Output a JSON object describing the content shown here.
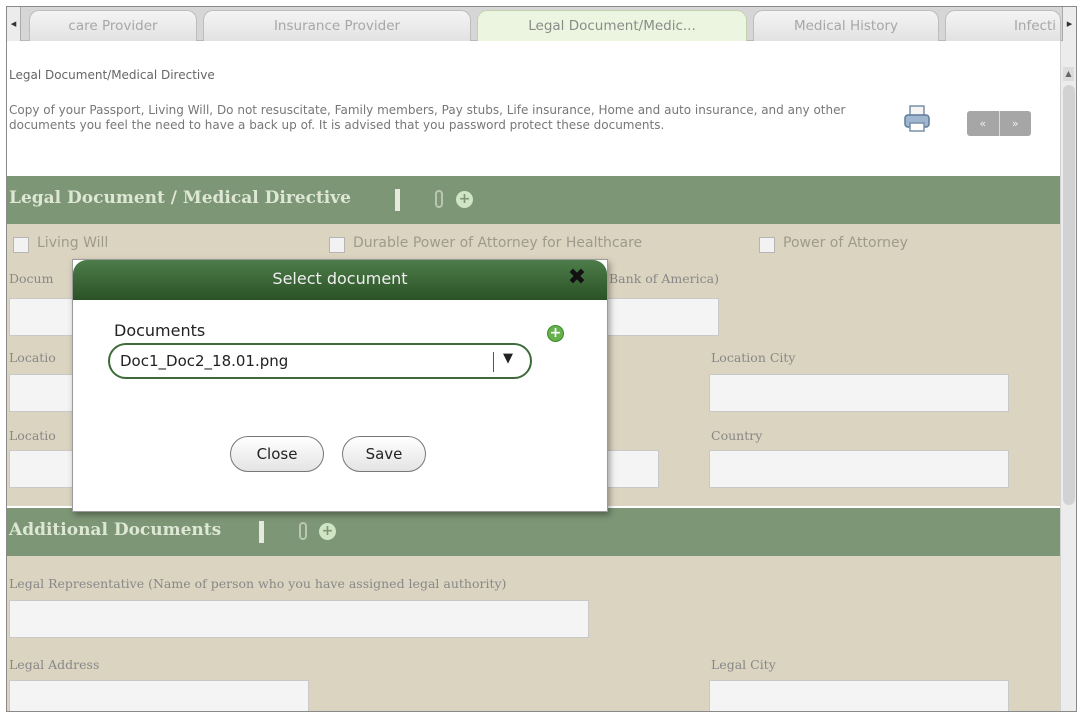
{
  "tabs": {
    "prev_arrow": "◂",
    "next_arrow": "▸",
    "items": [
      {
        "label": "care Provider"
      },
      {
        "label": "Insurance Provider"
      },
      {
        "label": "Legal Document/Medic..."
      },
      {
        "label": "Medical History"
      },
      {
        "label": "Infecti"
      }
    ],
    "active_index": 2
  },
  "page": {
    "breadcrumb": "Legal Document/Medical Directive",
    "description": "Copy of your Passport, Living Will, Do not resuscitate, Family members, Pay stubs, Life insurance, Home and auto insurance, and any other documents you feel the need to have a back up of. It is advised that you password protect these documents.",
    "pager_prev": "«",
    "pager_next": "»"
  },
  "section_legal": {
    "title": "Legal Document / Medical Directive",
    "checkboxes": [
      {
        "label": "Living Will",
        "checked": false
      },
      {
        "label": "Durable Power of Attorney for Healthcare",
        "checked": false
      },
      {
        "label": "Power of Attorney",
        "checked": false
      }
    ],
    "document_label": "Docum",
    "bank_hint": "Bank of America)",
    "location_label_1": "Locatio",
    "location_city_label": "Location City",
    "location_label_2": "Locatio",
    "country_label": "Country"
  },
  "section_additional": {
    "title": "Additional Documents",
    "legal_rep_label": "Legal Representative (Name of person who you have assigned legal authority)",
    "legal_address_label": "Legal Address",
    "legal_city_label": "Legal City"
  },
  "modal": {
    "title": "Select document",
    "close_glyph": "✖",
    "documents_label": "Documents",
    "add_glyph": "+",
    "selected_document": "Doc1_Doc2_18.01.png",
    "dropdown_glyph": "▼",
    "close_button": "Close",
    "save_button": "Save"
  },
  "colors": {
    "section_bar": "#7d9676",
    "panel_bg": "#dbd4c0",
    "modal_header": "#2a5226",
    "active_tab": "#ecf5df"
  },
  "icons": {
    "print": "printer-icon",
    "attach": "paperclip-icon",
    "add": "plus-circle-icon"
  }
}
